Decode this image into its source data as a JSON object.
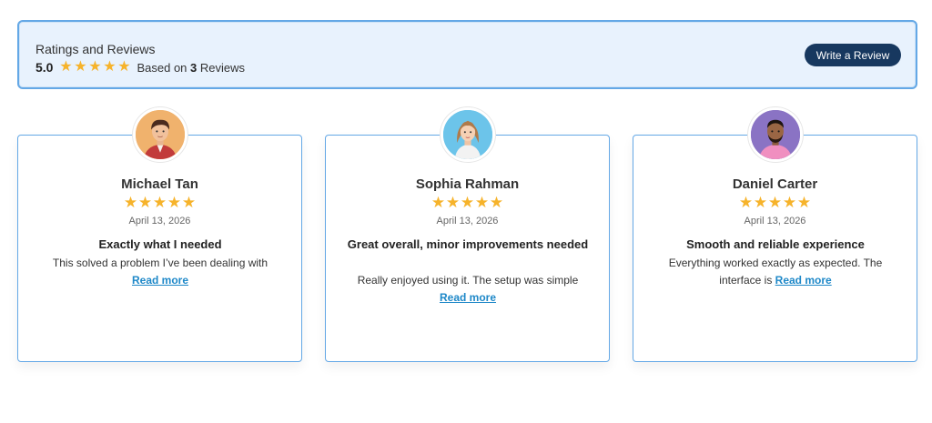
{
  "summary": {
    "title": "Ratings and Reviews",
    "average": "5.0",
    "based_prefix": "Based on",
    "count": "3",
    "based_suffix": "Reviews",
    "write_button": "Write a Review"
  },
  "reviews": [
    {
      "name": "Michael Tan",
      "rating": 5,
      "date": "April 13, 2026",
      "title": "Exactly what I needed",
      "text_line1": "This solved a problem I’ve been dealing with",
      "text_line2": "",
      "read_more": "Read more"
    },
    {
      "name": "Sophia Rahman",
      "rating": 5,
      "date": "April 13, 2026",
      "title": "Great overall, minor improvements needed",
      "text_line1": "Really enjoyed using it. The setup was simple",
      "text_line2": "",
      "read_more": "Read more"
    },
    {
      "name": "Daniel Carter",
      "rating": 5,
      "date": "April 13, 2026",
      "title": "Smooth and reliable experience",
      "text_line1": "Everything worked exactly as expected. The",
      "text_line2": "interface is",
      "read_more": "Read more"
    }
  ],
  "colors": {
    "star": "#f6b32b",
    "accent_border": "#64a8e6",
    "summary_bg": "#e8f2fd",
    "button_bg": "#17385f",
    "link": "#1e88c8"
  },
  "icons": {
    "star": "star-icon",
    "avatar": "avatar"
  }
}
